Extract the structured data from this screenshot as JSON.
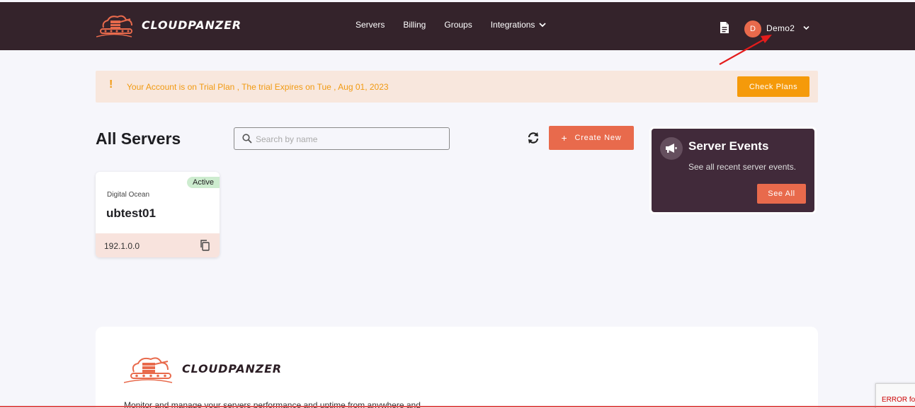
{
  "brand": {
    "name": "CLOUDPANZER"
  },
  "nav": {
    "items": [
      "Servers",
      "Billing",
      "Groups",
      "Integrations"
    ]
  },
  "user": {
    "initial": "D",
    "name": "Demo2"
  },
  "trial": {
    "message": "Your Account is on Trial Plan , The trial Expires on Tue , Aug 01, 2023",
    "button": "Check Plans"
  },
  "servers": {
    "title": "All Servers",
    "search_placeholder": "Search by name",
    "create_label": "Create New",
    "items": [
      {
        "provider": "Digital Ocean",
        "name": "ubtest01",
        "status": "Active",
        "ip": "192.1.0.0"
      }
    ]
  },
  "events": {
    "title": "Server Events",
    "subtitle": "See all recent server events.",
    "button": "See All"
  },
  "footer": {
    "brand": "CLOUDPANZER",
    "description": "Monitor and manage your servers performance and uptime from anywhere and"
  },
  "recaptcha": {
    "text": "ERROR for"
  },
  "colors": {
    "topbar": "#34232b",
    "accent": "#e86a4c",
    "warning": "#f59a0a",
    "events_bg": "#412a3a"
  }
}
